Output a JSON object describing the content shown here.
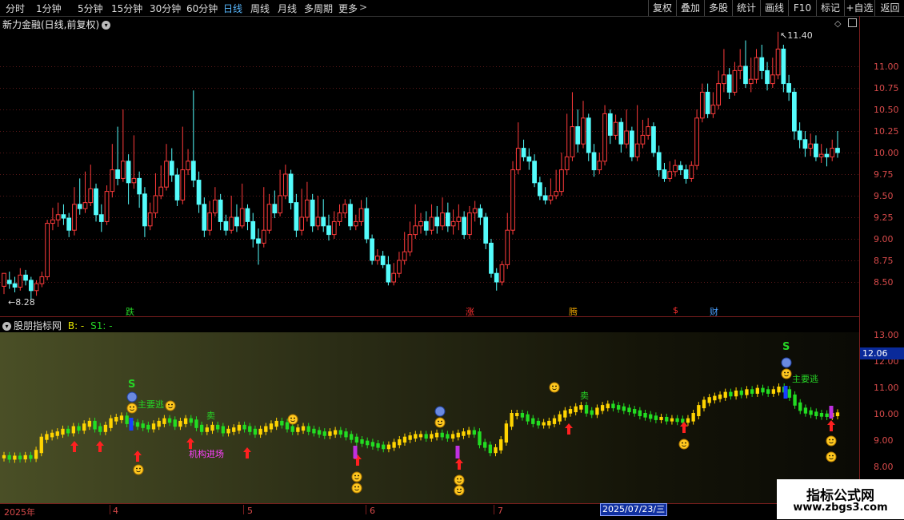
{
  "toolbar": {
    "periods": [
      "分时",
      "1分钟",
      "5分钟",
      "15分钟",
      "30分钟",
      "60分钟",
      "日线",
      "周线",
      "月线",
      "多周期",
      "更多"
    ],
    "active_period": "日线",
    "right_buttons": [
      "复权",
      "叠加",
      "多股",
      "统计",
      "画线",
      "F10",
      "标记",
      "+自选",
      "返回"
    ]
  },
  "main_chart": {
    "title": "新力金融(日线,前复权)",
    "high_marker": "11.40",
    "low_marker": "8.28",
    "y_axis_ticks": [
      "11.00",
      "10.75",
      "10.50",
      "10.25",
      "10.00",
      "9.75",
      "9.50",
      "9.25",
      "9.00",
      "8.75",
      "8.50"
    ],
    "event_tags": [
      {
        "text": "跌",
        "color": "#26d426"
      },
      {
        "text": "涨",
        "color": "#ff3030"
      },
      {
        "text": "腾",
        "color": "#e8a000"
      },
      {
        "text": "$",
        "color": "#ff3030"
      },
      {
        "text": "财",
        "color": "#4aa0ff"
      }
    ]
  },
  "sub_chart": {
    "title": "股朋指标网",
    "b_label": "B: -",
    "s1_label": "S1: -",
    "y_axis_ticks": [
      "13.00",
      "12.00",
      "11.00",
      "10.00",
      "9.00",
      "8.00"
    ],
    "current_value": "12.06",
    "signals": {
      "s_mark": "S",
      "escape_text": "主要逃",
      "sell_text": "卖",
      "inst_text": "机构进场"
    }
  },
  "x_axis": {
    "labels": [
      "2025年",
      "4",
      "5",
      "6",
      "7"
    ],
    "highlight_date": "2025/07/23/三"
  },
  "watermark": {
    "line1": "指标公式网",
    "line2": "www.zbgs3.com"
  },
  "colors": {
    "up": "#ff3b3b",
    "down": "#54fcfc",
    "axis": "#d84a4a",
    "sub_up": "#ffd400",
    "sub_down": "#22dd22"
  },
  "chart_data": {
    "type": "candlestick",
    "price_range": [
      8.3,
      11.4
    ],
    "series": [
      {
        "name": "candles",
        "values": [
          [
            8.45,
            8.6,
            8.36,
            8.52
          ],
          [
            8.52,
            8.48,
            8.42,
            8.62
          ],
          [
            8.48,
            8.44,
            8.38,
            8.56
          ],
          [
            8.44,
            8.58,
            8.4,
            8.66
          ],
          [
            8.58,
            8.52,
            8.46,
            8.64
          ],
          [
            8.52,
            8.4,
            8.3,
            8.56
          ],
          [
            8.4,
            8.48,
            8.34,
            8.52
          ],
          [
            8.48,
            8.56,
            8.44,
            8.62
          ],
          [
            8.56,
            9.18,
            8.52,
            9.22
          ],
          [
            9.18,
            9.22,
            9.1,
            9.36
          ],
          [
            9.22,
            9.28,
            9.14,
            9.42
          ],
          [
            9.28,
            9.24,
            9.16,
            9.4
          ],
          [
            9.24,
            9.1,
            9.02,
            9.3
          ],
          [
            9.1,
            9.4,
            9.04,
            9.6
          ],
          [
            9.4,
            9.35,
            9.28,
            9.7
          ],
          [
            9.35,
            9.42,
            9.3,
            9.78
          ],
          [
            9.42,
            9.58,
            9.38,
            9.86
          ],
          [
            9.58,
            9.28,
            9.2,
            9.64
          ],
          [
            9.28,
            9.2,
            9.08,
            9.4
          ],
          [
            9.2,
            9.55,
            9.16,
            9.62
          ],
          [
            9.55,
            9.8,
            9.48,
            10.1
          ],
          [
            9.8,
            9.7,
            9.62,
            10.3
          ],
          [
            9.7,
            9.9,
            9.66,
            10.5
          ],
          [
            9.9,
            9.65,
            9.4,
            9.98
          ],
          [
            9.65,
            9.7,
            9.58,
            10.2
          ],
          [
            9.7,
            9.52,
            9.36,
            9.78
          ],
          [
            9.52,
            9.15,
            9.02,
            9.6
          ],
          [
            9.15,
            9.3,
            9.1,
            9.42
          ],
          [
            9.3,
            9.5,
            9.24,
            9.76
          ],
          [
            9.5,
            9.6,
            9.46,
            9.85
          ],
          [
            9.6,
            9.9,
            9.56,
            10.1
          ],
          [
            9.9,
            9.74,
            9.66,
            10.05
          ],
          [
            9.74,
            9.45,
            9.38,
            9.82
          ],
          [
            9.45,
            9.8,
            9.4,
            10.3
          ],
          [
            9.8,
            9.9,
            9.74,
            10.04
          ],
          [
            9.9,
            9.68,
            9.6,
            10.72
          ],
          [
            9.68,
            9.4,
            9.3,
            9.78
          ],
          [
            9.4,
            9.1,
            9.02,
            9.48
          ],
          [
            9.1,
            9.3,
            9.04,
            9.44
          ],
          [
            9.3,
            9.45,
            9.26,
            9.6
          ],
          [
            9.45,
            9.2,
            9.1,
            9.52
          ],
          [
            9.2,
            9.1,
            9.04,
            9.28
          ],
          [
            9.1,
            9.25,
            9.06,
            9.5
          ],
          [
            9.25,
            9.15,
            9.08,
            9.4
          ],
          [
            9.15,
            9.35,
            9.12,
            9.64
          ],
          [
            9.35,
            9.2,
            9.1,
            9.4
          ],
          [
            9.2,
            9.0,
            8.9,
            9.3
          ],
          [
            9.0,
            8.95,
            8.7,
            9.12
          ],
          [
            8.95,
            9.1,
            8.9,
            9.6
          ],
          [
            9.1,
            9.4,
            9.06,
            9.52
          ],
          [
            9.4,
            9.3,
            9.24,
            9.56
          ],
          [
            9.3,
            9.5,
            9.26,
            9.8
          ],
          [
            9.5,
            9.75,
            9.46,
            9.86
          ],
          [
            9.75,
            9.42,
            9.34,
            9.8
          ],
          [
            9.42,
            9.1,
            9.02,
            9.52
          ],
          [
            9.1,
            9.25,
            9.04,
            9.58
          ],
          [
            9.25,
            9.45,
            9.2,
            9.66
          ],
          [
            9.45,
            9.15,
            9.08,
            9.52
          ],
          [
            9.15,
            9.25,
            9.1,
            9.5
          ],
          [
            9.25,
            9.15,
            9.08,
            9.46
          ],
          [
            9.15,
            9.05,
            8.98,
            9.28
          ],
          [
            9.05,
            9.2,
            9.0,
            9.32
          ],
          [
            9.2,
            9.3,
            9.15,
            9.4
          ],
          [
            9.3,
            9.4,
            9.24,
            9.46
          ],
          [
            9.4,
            9.15,
            9.1,
            9.46
          ],
          [
            9.15,
            9.2,
            9.1,
            9.28
          ],
          [
            9.2,
            9.35,
            9.15,
            9.45
          ],
          [
            9.35,
            9.0,
            8.95,
            9.48
          ],
          [
            9.0,
            8.75,
            8.7,
            9.05
          ],
          [
            8.75,
            8.8,
            8.7,
            8.88
          ],
          [
            8.8,
            8.7,
            8.66,
            8.86
          ],
          [
            8.7,
            8.5,
            8.46,
            8.8
          ],
          [
            8.5,
            8.6,
            8.46,
            8.72
          ],
          [
            8.6,
            8.75,
            8.55,
            8.85
          ],
          [
            8.75,
            8.85,
            8.7,
            9.08
          ],
          [
            8.85,
            9.05,
            8.8,
            9.2
          ],
          [
            9.05,
            9.15,
            9.0,
            9.4
          ],
          [
            9.15,
            9.2,
            9.06,
            9.3
          ],
          [
            9.2,
            9.1,
            9.04,
            9.32
          ],
          [
            9.1,
            9.25,
            9.05,
            9.4
          ],
          [
            9.25,
            9.15,
            9.06,
            9.38
          ],
          [
            9.15,
            9.3,
            9.1,
            9.48
          ],
          [
            9.3,
            9.15,
            9.08,
            9.42
          ],
          [
            9.15,
            9.2,
            9.05,
            9.34
          ],
          [
            9.2,
            9.25,
            9.1,
            9.4
          ],
          [
            9.25,
            9.05,
            9.0,
            9.32
          ],
          [
            9.05,
            9.3,
            9.0,
            9.38
          ],
          [
            9.3,
            9.35,
            9.2,
            9.44
          ],
          [
            9.35,
            9.25,
            9.16,
            9.4
          ],
          [
            9.25,
            8.95,
            8.88,
            9.3
          ],
          [
            8.95,
            8.6,
            8.55,
            9.0
          ],
          [
            8.6,
            8.5,
            8.4,
            8.66
          ],
          [
            8.5,
            8.7,
            8.46,
            8.74
          ],
          [
            8.7,
            9.1,
            8.65,
            9.3
          ],
          [
            9.1,
            9.8,
            9.05,
            9.9
          ],
          [
            9.8,
            10.05,
            9.75,
            10.35
          ],
          [
            10.05,
            9.95,
            9.9,
            10.15
          ],
          [
            9.95,
            9.9,
            9.8,
            10.05
          ],
          [
            9.9,
            9.65,
            9.6,
            9.98
          ],
          [
            9.65,
            9.5,
            9.45,
            9.72
          ],
          [
            9.5,
            9.45,
            9.4,
            9.6
          ],
          [
            9.45,
            9.5,
            9.4,
            9.7
          ],
          [
            9.5,
            9.55,
            9.46,
            9.8
          ],
          [
            9.55,
            9.8,
            9.5,
            10.0
          ],
          [
            9.8,
            9.95,
            9.74,
            10.45
          ],
          [
            9.95,
            10.3,
            9.9,
            10.7
          ],
          [
            10.3,
            10.1,
            10.0,
            10.5
          ],
          [
            10.1,
            10.4,
            10.05,
            10.6
          ],
          [
            10.4,
            10.0,
            9.9,
            10.45
          ],
          [
            10.0,
            9.8,
            9.72,
            10.1
          ],
          [
            9.8,
            9.9,
            9.75,
            10.0
          ],
          [
            9.9,
            10.45,
            9.85,
            10.55
          ],
          [
            10.45,
            10.2,
            10.1,
            10.5
          ],
          [
            10.2,
            10.35,
            10.15,
            10.44
          ],
          [
            10.35,
            10.1,
            10.0,
            10.4
          ],
          [
            10.1,
            10.25,
            10.05,
            10.5
          ],
          [
            10.25,
            9.95,
            9.9,
            10.3
          ],
          [
            9.95,
            10.1,
            9.9,
            10.55
          ],
          [
            10.1,
            10.2,
            10.05,
            10.38
          ],
          [
            10.2,
            10.3,
            10.15,
            10.4
          ],
          [
            10.3,
            10.0,
            9.95,
            10.35
          ],
          [
            10.0,
            9.8,
            9.72,
            10.08
          ],
          [
            9.8,
            9.7,
            9.66,
            9.88
          ],
          [
            9.7,
            9.78,
            9.66,
            9.9
          ],
          [
            9.78,
            9.85,
            9.72,
            9.92
          ],
          [
            9.85,
            9.8,
            9.74,
            9.9
          ],
          [
            9.8,
            9.7,
            9.64,
            9.86
          ],
          [
            9.7,
            9.85,
            9.66,
            9.9
          ],
          [
            9.85,
            10.4,
            9.8,
            10.5
          ],
          [
            10.4,
            10.7,
            10.35,
            10.8
          ],
          [
            10.7,
            10.45,
            10.4,
            10.8
          ],
          [
            10.45,
            10.55,
            10.4,
            10.7
          ],
          [
            10.55,
            10.8,
            10.5,
            10.95
          ],
          [
            10.8,
            10.9,
            10.7,
            11.2
          ],
          [
            10.9,
            10.7,
            10.62,
            10.98
          ],
          [
            10.7,
            10.95,
            10.66,
            11.05
          ],
          [
            10.95,
            11.0,
            10.85,
            11.2
          ],
          [
            11.0,
            10.8,
            10.75,
            11.3
          ],
          [
            10.8,
            10.85,
            10.7,
            11.1
          ],
          [
            10.85,
            11.1,
            10.8,
            11.2
          ],
          [
            11.1,
            10.95,
            10.85,
            11.25
          ],
          [
            10.95,
            10.8,
            10.72,
            11.05
          ],
          [
            10.8,
            10.9,
            10.75,
            11.1
          ],
          [
            10.9,
            11.2,
            10.85,
            11.4
          ],
          [
            11.2,
            10.8,
            10.7,
            11.25
          ],
          [
            10.8,
            10.7,
            10.6,
            10.9
          ],
          [
            10.7,
            10.25,
            10.15,
            10.75
          ],
          [
            10.25,
            10.15,
            10.05,
            10.35
          ],
          [
            10.15,
            10.05,
            9.95,
            10.25
          ],
          [
            10.05,
            10.1,
            9.96,
            10.22
          ],
          [
            10.1,
            9.95,
            9.9,
            10.2
          ],
          [
            9.95,
            9.98,
            9.88,
            10.1
          ],
          [
            9.98,
            9.95,
            9.84,
            10.05
          ],
          [
            9.95,
            10.05,
            9.9,
            10.15
          ],
          [
            10.05,
            10.0,
            9.94,
            10.25
          ]
        ]
      },
      {
        "name": "indicator",
        "values": [
          8.4,
          8.35,
          8.38,
          8.36,
          8.4,
          8.38,
          8.6,
          9.1,
          9.2,
          9.25,
          9.3,
          9.4,
          9.35,
          9.5,
          9.45,
          9.6,
          9.7,
          9.5,
          9.4,
          9.55,
          9.8,
          9.85,
          9.9,
          9.7,
          9.65,
          9.6,
          9.55,
          9.5,
          9.6,
          9.7,
          9.8,
          9.75,
          9.6,
          9.7,
          9.8,
          9.75,
          9.55,
          9.4,
          9.45,
          9.55,
          9.5,
          9.35,
          9.4,
          9.45,
          9.55,
          9.5,
          9.4,
          9.3,
          9.4,
          9.5,
          9.6,
          9.7,
          9.65,
          9.5,
          9.4,
          9.45,
          9.5,
          9.4,
          9.35,
          9.3,
          9.25,
          9.3,
          9.35,
          9.3,
          9.2,
          9.1,
          9.0,
          8.95,
          8.9,
          8.85,
          8.8,
          8.75,
          8.8,
          8.9,
          9.0,
          9.1,
          9.15,
          9.2,
          9.2,
          9.15,
          9.2,
          9.25,
          9.2,
          9.15,
          9.2,
          9.25,
          9.3,
          9.35,
          9.3,
          8.9,
          8.8,
          8.6,
          8.7,
          9.0,
          9.6,
          10.0,
          10.0,
          9.95,
          9.8,
          9.7,
          9.65,
          9.65,
          9.7,
          9.8,
          9.95,
          10.1,
          10.15,
          10.25,
          10.3,
          10.1,
          10.05,
          10.2,
          10.3,
          10.35,
          10.3,
          10.25,
          10.2,
          10.15,
          10.1,
          10.0,
          9.95,
          9.9,
          9.85,
          9.85,
          9.8,
          9.8,
          9.78,
          9.75,
          9.8,
          10.0,
          10.3,
          10.5,
          10.6,
          10.65,
          10.7,
          10.8,
          10.75,
          10.85,
          10.8,
          10.9,
          10.85,
          10.95,
          10.9,
          10.85,
          10.9,
          11.0,
          10.9,
          10.7,
          10.4,
          10.2,
          10.1,
          10.05,
          10.0,
          9.98,
          9.97,
          10.0,
          10.02
        ]
      }
    ]
  }
}
